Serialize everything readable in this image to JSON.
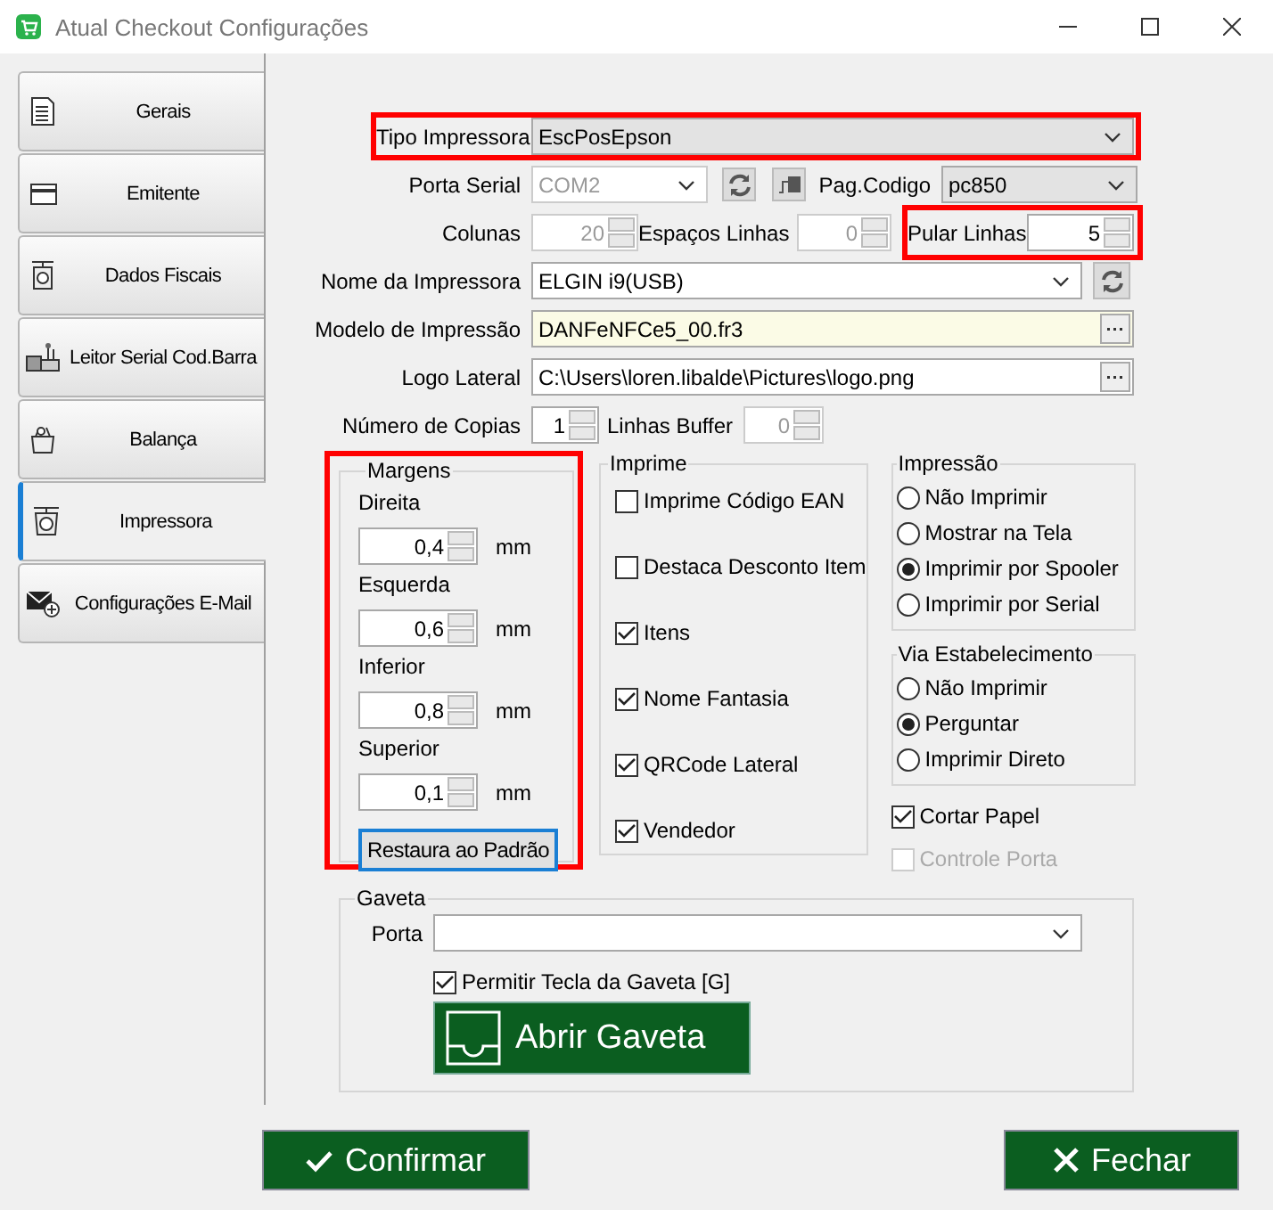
{
  "window": {
    "title": "Atual Checkout Configurações"
  },
  "sidebar": {
    "items": [
      {
        "label": "Gerais",
        "selected": false
      },
      {
        "label": "Emitente",
        "selected": false
      },
      {
        "label": "Dados Fiscais",
        "selected": false
      },
      {
        "label": "Leitor Serial Cod.Barra",
        "selected": false
      },
      {
        "label": "Balança",
        "selected": false
      },
      {
        "label": "Impressora",
        "selected": true
      },
      {
        "label": "Configurações E-Mail",
        "selected": false
      }
    ]
  },
  "printer": {
    "tipo_impressora": {
      "label": "Tipo Impressora",
      "value": "EscPosEpson",
      "highlighted": true
    },
    "porta_serial": {
      "label": "Porta Serial",
      "value": "COM2",
      "disabled": true
    },
    "pag_codigo": {
      "label": "Pag.Codigo",
      "value": "pc850"
    },
    "colunas": {
      "label": "Colunas",
      "value": "20",
      "disabled": true
    },
    "espacos_linhas": {
      "label": "Espaços Linhas",
      "value": "0",
      "disabled": true
    },
    "pular_linhas": {
      "label": "Pular Linhas",
      "value": "5",
      "highlighted": true
    },
    "nome_impressora": {
      "label": "Nome da Impressora",
      "value": "ELGIN i9(USB)"
    },
    "modelo_impressao": {
      "label": "Modelo de Impressão",
      "value": "DANFeNFCe5_00.fr3"
    },
    "logo_lateral": {
      "label": "Logo Lateral",
      "value": "C:\\Users\\loren.libalde\\Pictures\\logo.png"
    },
    "numero_copias": {
      "label": "Número de Copias",
      "value": "1"
    },
    "linhas_buffer": {
      "label": "Linhas Buffer",
      "value": "0",
      "disabled": true
    }
  },
  "margens": {
    "title": "Margens",
    "highlighted": true,
    "fields": [
      {
        "label": "Direita",
        "value": "0,4",
        "unit": "mm"
      },
      {
        "label": "Esquerda",
        "value": "0,6",
        "unit": "mm"
      },
      {
        "label": "Inferior",
        "value": "0,8",
        "unit": "mm"
      },
      {
        "label": "Superior",
        "value": "0,1",
        "unit": "mm"
      }
    ],
    "restore_button": "Restaura ao Padrão"
  },
  "imprime": {
    "title": "Imprime",
    "options": [
      {
        "label": "Imprime Código EAN",
        "checked": false
      },
      {
        "label": "Destaca Desconto Item",
        "checked": false
      },
      {
        "label": "Itens",
        "checked": true
      },
      {
        "label": "Nome Fantasia",
        "checked": true
      },
      {
        "label": "QRCode Lateral",
        "checked": true
      },
      {
        "label": "Vendedor",
        "checked": true
      }
    ]
  },
  "impressao": {
    "title": "Impressão",
    "options": [
      {
        "label": "Não Imprimir",
        "selected": false
      },
      {
        "label": "Mostrar na Tela",
        "selected": false
      },
      {
        "label": "Imprimir por Spooler",
        "selected": true
      },
      {
        "label": "Imprimir por Serial",
        "selected": false
      }
    ]
  },
  "via_estabelecimento": {
    "title": "Via Estabelecimento",
    "options": [
      {
        "label": "Não Imprimir",
        "selected": false
      },
      {
        "label": "Perguntar",
        "selected": true
      },
      {
        "label": "Imprimir Direto",
        "selected": false
      }
    ]
  },
  "extra_options": [
    {
      "label": "Cortar Papel",
      "checked": true,
      "disabled": false
    },
    {
      "label": "Controle Porta",
      "checked": false,
      "disabled": true
    }
  ],
  "gaveta": {
    "title": "Gaveta",
    "porta_label": "Porta",
    "permitir": {
      "label": "Permitir Tecla da Gaveta [G]",
      "checked": true
    },
    "open_button": "Abrir Gaveta"
  },
  "buttons": [
    {
      "label": "Confirmar",
      "kind": "confirm"
    },
    {
      "label": "Fechar",
      "kind": "close"
    }
  ]
}
